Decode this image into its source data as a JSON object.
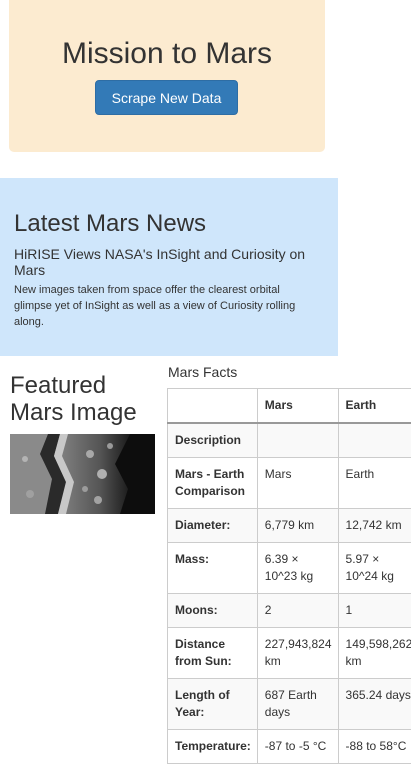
{
  "header": {
    "title": "Mission to Mars",
    "scrape_label": "Scrape New Data"
  },
  "news": {
    "heading": "Latest Mars News",
    "title": "HiRISE Views NASA's InSight and Curiosity on Mars",
    "paragraph": "New images taken from space offer the clearest orbital glimpse yet of InSight as well as a view of Curiosity rolling along."
  },
  "featured": {
    "heading": "Featured Mars Image"
  },
  "facts": {
    "caption": "Mars Facts",
    "columns": [
      "",
      "Mars",
      "Earth"
    ],
    "rows": [
      {
        "label": "Description",
        "mars": "",
        "earth": ""
      },
      {
        "label": "Mars - Earth Comparison",
        "mars": "Mars",
        "earth": "Earth"
      },
      {
        "label": "Diameter:",
        "mars": "6,779 km",
        "earth": "12,742 km"
      },
      {
        "label": "Mass:",
        "mars": "6.39 × 10^23 kg",
        "earth": "5.97 × 10^24 kg"
      },
      {
        "label": "Moons:",
        "mars": "2",
        "earth": "1"
      },
      {
        "label": "Distance from Sun:",
        "mars": "227,943,824 km",
        "earth": "149,598,262 km"
      },
      {
        "label": "Length of Year:",
        "mars": "687 Earth days",
        "earth": "365.24 days"
      },
      {
        "label": "Temperature:",
        "mars": "-87 to -5 °C",
        "earth": "-88 to 58°C"
      }
    ]
  }
}
